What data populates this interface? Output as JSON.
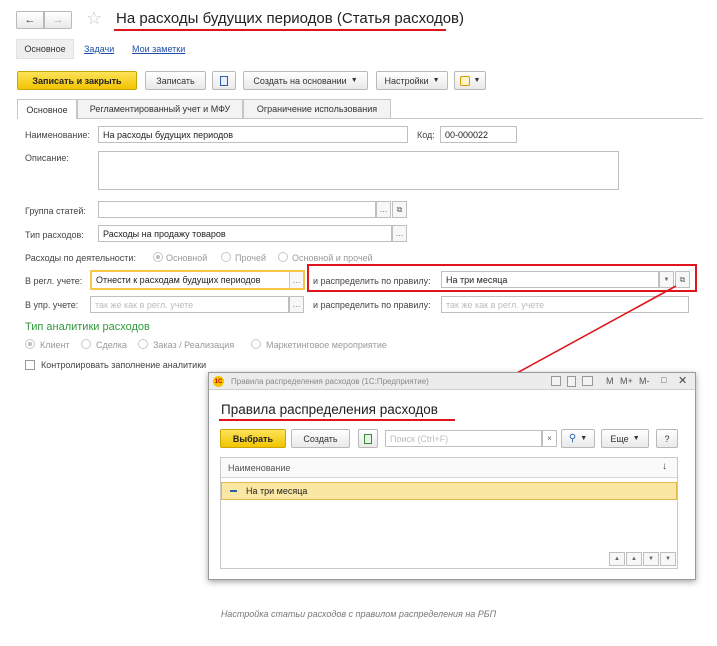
{
  "header": {
    "back_icon": "arrow-left",
    "forward_icon": "arrow-right",
    "star_icon": "star",
    "title": "На расходы будущих периодов (Статья расходов)"
  },
  "nav": {
    "main": "Основное",
    "tasks": "Задачи",
    "notes": "Мои заметки"
  },
  "toolbar": {
    "save_close": "Записать и закрыть",
    "save": "Записать",
    "create_based": "Создать на основании",
    "settings": "Настройки"
  },
  "tabs": [
    "Основное",
    "Регламентированный учет и МФУ",
    "Ограничение использования"
  ],
  "form": {
    "name_label": "Наименование:",
    "name_value": "На расходы будущих периодов",
    "code_label": "Код:",
    "code_value": "00-000022",
    "description_label": "Описание:",
    "group_label": "Группа статей:",
    "type_label": "Тип расходов:",
    "type_value": "Расходы на продажу товаров",
    "activity_label": "Расходы по деятельности:",
    "activity_options": [
      "Основной",
      "Прочей",
      "Основной и прочей"
    ],
    "reg_label": "В регл. учете:",
    "reg_value": "Отнести к расходам будущих периодов",
    "distribute_label": "и распределить по правилу:",
    "distribute_value": "На три месяца",
    "mgmt_label": "В упр. учете:",
    "mgmt_placeholder": "так же как в регл. учете",
    "distribute2_label": "и распределить по правилу:",
    "distribute2_placeholder": "так же как в регл. учете",
    "analytics_title": "Тип аналитики расходов",
    "analytics_options": [
      "Клиент",
      "Сделка",
      "Заказ / Реализация",
      "Маркетинговое мероприятие"
    ],
    "control_label": "Контролировать заполнение аналитики"
  },
  "dialog": {
    "window_title": "Правила распределения расходов  (1С:Предприятие)",
    "heading": "Правила распределения расходов",
    "select": "Выбрать",
    "create": "Создать",
    "search_placeholder": "Поиск (Ctrl+F)",
    "more": "Еще",
    "help": "?",
    "column": "Наименование",
    "rows": [
      "На три месяца"
    ],
    "title_buttons": [
      "M",
      "M+",
      "M-"
    ]
  },
  "caption": "Настройка статьи расходов с правилом распределения на РБП",
  "colors": {
    "highlight": "#e0151b",
    "accent_yellow": "#f7d21e",
    "green_title": "#2e9a3a"
  }
}
